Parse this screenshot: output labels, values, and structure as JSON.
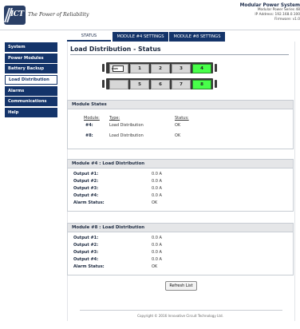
{
  "header": {
    "tagline": "The Power of Reliability",
    "logo_text": "ICT",
    "system_title": "Modular Power System",
    "lines": [
      "Modular Power Series 48",
      "IP Address: 192.168.0.100",
      "Firmware: v1.0"
    ]
  },
  "sidebar": {
    "items": [
      {
        "label": "System"
      },
      {
        "label": "Power Modules"
      },
      {
        "label": "Battery Backup"
      },
      {
        "label": "Load Distribution",
        "active": true
      },
      {
        "label": "Alarms"
      },
      {
        "label": "Communications"
      },
      {
        "label": "Help"
      }
    ]
  },
  "tabs": [
    {
      "label": "STATUS",
      "active": true
    },
    {
      "label": "MODULE #4 SETTINGS"
    },
    {
      "label": "MODULE #8 SETTINGS"
    }
  ],
  "page_title": "Load Distribution - Status",
  "modules_display": {
    "row1": {
      "icon_label": "PWR",
      "cells": [
        "1",
        "2",
        "3",
        "4"
      ],
      "active": "4"
    },
    "row2": {
      "cells": [
        "",
        "5",
        "6",
        "7",
        "8"
      ],
      "active": "8"
    }
  },
  "module_states": {
    "title": "Module States",
    "headers": {
      "module": "Module:",
      "type": "Type:",
      "status": "Status:"
    },
    "rows": [
      {
        "module": "#4:",
        "type": "Load Distribution",
        "status": "OK"
      },
      {
        "module": "#8:",
        "type": "Load Distribution",
        "status": "OK"
      }
    ]
  },
  "module4": {
    "title": "Module #4 : Load Distribution",
    "rows": [
      {
        "label": "Output #1:",
        "value": "0.0 A"
      },
      {
        "label": "Output #2:",
        "value": "0.0 A"
      },
      {
        "label": "Output #3:",
        "value": "0.0 A"
      },
      {
        "label": "Output #4:",
        "value": "0.0 A"
      },
      {
        "label": "Alarm Status:",
        "value": "OK"
      }
    ]
  },
  "module8": {
    "title": "Module #8 : Load Distribution",
    "rows": [
      {
        "label": "Output #1:",
        "value": "0.0 A"
      },
      {
        "label": "Output #2:",
        "value": "0.0 A"
      },
      {
        "label": "Output #3:",
        "value": "0.0 A"
      },
      {
        "label": "Output #4:",
        "value": "0.0 A"
      },
      {
        "label": "Alarm Status:",
        "value": "OK"
      }
    ]
  },
  "refresh_label": "Refresh List",
  "footer": "Copyright © 2016 Innovative Circuit Technology Ltd.",
  "colors": {
    "nav": "#14346a",
    "module_on": "#48ff4a",
    "module_off": "#d7d7d7"
  }
}
